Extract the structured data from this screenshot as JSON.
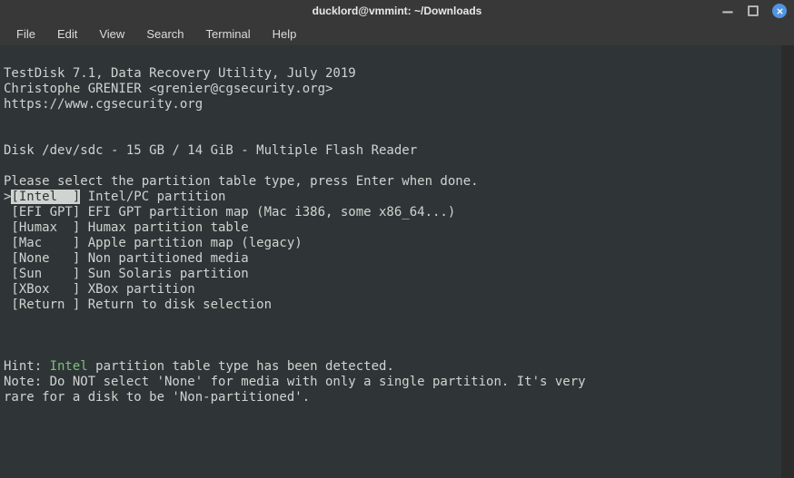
{
  "window": {
    "title": "ducklord@vmmint: ~/Downloads"
  },
  "menu": {
    "file": "File",
    "edit": "Edit",
    "view": "View",
    "search": "Search",
    "terminal": "Terminal",
    "help": "Help"
  },
  "term": {
    "l1": "TestDisk 7.1, Data Recovery Utility, July 2019",
    "l2": "Christophe GRENIER <grenier@cgsecurity.org>",
    "l3": "https://www.cgsecurity.org",
    "blank": "",
    "disk": "Disk /dev/sdc - 15 GB / 14 GiB - Multiple Flash Reader",
    "prompt": "Please select the partition table type, press Enter when done.",
    "sel_marker": ">",
    "sel_item": "[Intel  ]",
    "sel_desc": " Intel/PC partition",
    "opt_efi": " [EFI GPT] EFI GPT partition map (Mac i386, some x86_64...)",
    "opt_humax": " [Humax  ] Humax partition table",
    "opt_mac": " [Mac    ] Apple partition map (legacy)",
    "opt_none": " [None   ] Non partitioned media",
    "opt_sun": " [Sun    ] Sun Solaris partition",
    "opt_xbox": " [XBox   ] XBox partition",
    "opt_return": " [Return ] Return to disk selection",
    "hint_pre": "Hint: ",
    "hint_kw": "Intel",
    "hint_post": " partition table type has been detected.",
    "note1": "Note: Do NOT select 'None' for media with only a single partition. It's very",
    "note2": "rare for a disk to be 'Non-partitioned'."
  }
}
